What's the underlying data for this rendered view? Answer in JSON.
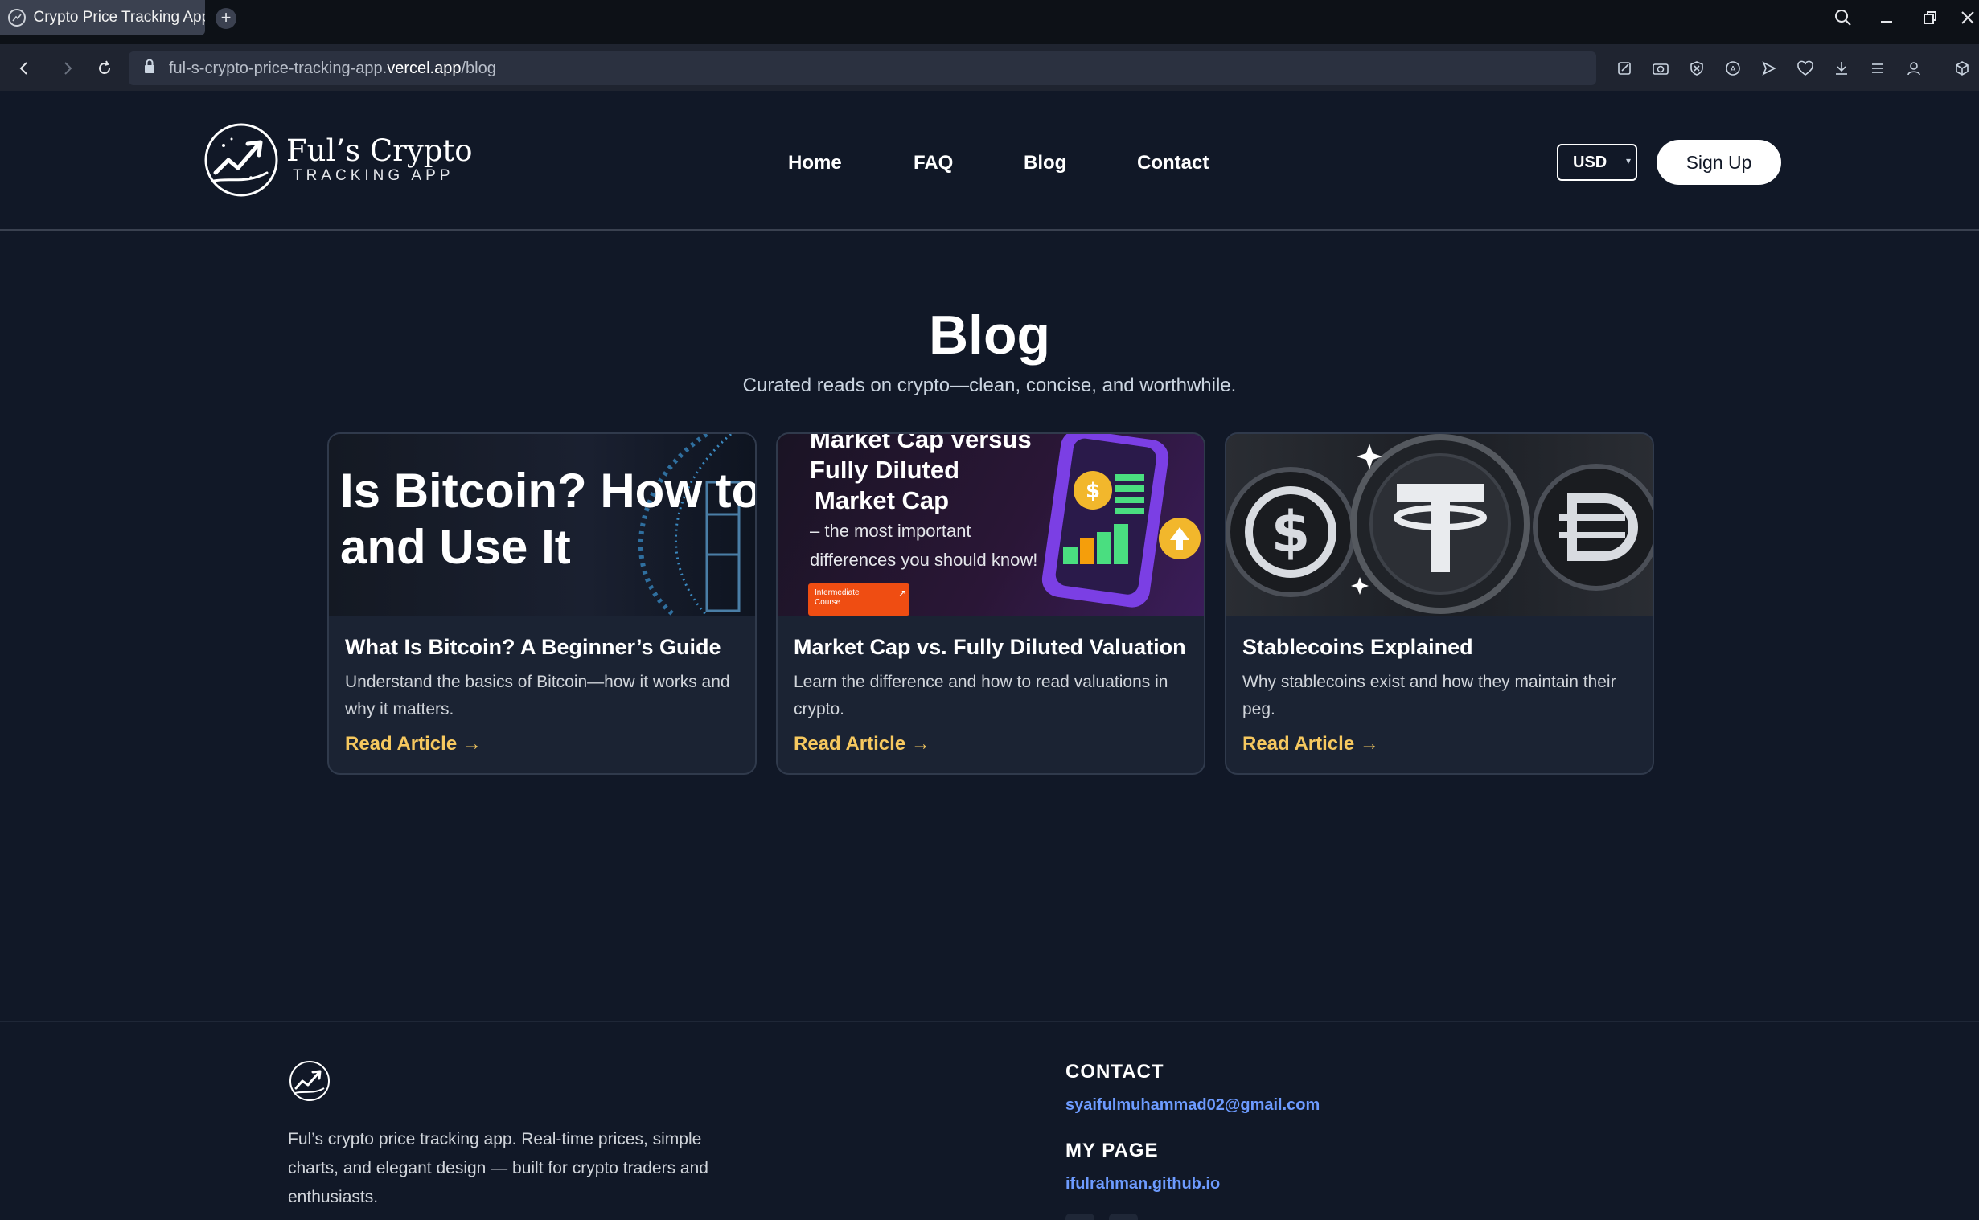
{
  "browser": {
    "tab_title": "Crypto Price Tracking App",
    "new_tab": "+",
    "url_prefix": "ful-s-crypto-price-tracking-app.",
    "url_domain": "vercel.app",
    "url_path": "/blog"
  },
  "header": {
    "logo_name": "Ful’s Crypto",
    "logo_sub": "TRACKING APP",
    "nav": [
      "Home",
      "FAQ",
      "Blog",
      "Contact"
    ],
    "currency": "USD",
    "signup": "Sign Up"
  },
  "hero": {
    "title": "Blog",
    "subtitle": "Curated reads on crypto—clean, concise, and worthwhile."
  },
  "cards": [
    {
      "image_text": [
        "Is Bitcoin? How to I",
        "and Use It"
      ],
      "title": "What Is Bitcoin? A Beginner’s Guide",
      "desc": "Understand the basics of Bitcoin—how it works and why it matters.",
      "link": "Read Article →"
    },
    {
      "image_text": [
        "Market Cap versus",
        "Fully Diluted",
        "Market Cap",
        "– the most important",
        "differences you should know!",
        "Intermediate Course"
      ],
      "title": "Market Cap vs. Fully Diluted Valuation",
      "desc": "Learn the difference and how to read valuations in crypto.",
      "link": "Read Article →"
    },
    {
      "image_text": [],
      "title": "Stablecoins Explained",
      "desc": "Why stablecoins exist and how they maintain their peg.",
      "link": "Read Article →"
    }
  ],
  "footer": {
    "about": "Ful’s crypto price tracking app. Real-time prices, simple charts, and elegant design — built for crypto traders and enthusiasts.",
    "contact_heading": "CONTACT",
    "email": "syaifulmuhammad02@gmail.com",
    "mypage_heading": "MY PAGE",
    "mypage": "ifulrahman.github.io"
  },
  "colors": {
    "background": "#111827",
    "card": "#1b2333",
    "accent_link": "#f6c85f",
    "footer_link": "#6d9bff"
  }
}
